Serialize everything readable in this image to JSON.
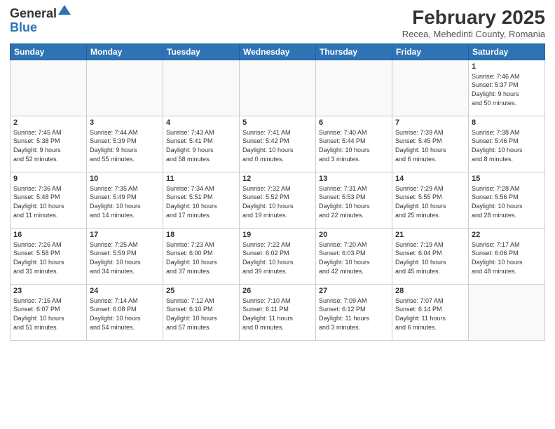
{
  "header": {
    "logo_general": "General",
    "logo_blue": "Blue",
    "month_title": "February 2025",
    "location": "Recea, Mehedinti County, Romania"
  },
  "weekdays": [
    "Sunday",
    "Monday",
    "Tuesday",
    "Wednesday",
    "Thursday",
    "Friday",
    "Saturday"
  ],
  "weeks": [
    [
      {
        "day": "",
        "info": ""
      },
      {
        "day": "",
        "info": ""
      },
      {
        "day": "",
        "info": ""
      },
      {
        "day": "",
        "info": ""
      },
      {
        "day": "",
        "info": ""
      },
      {
        "day": "",
        "info": ""
      },
      {
        "day": "1",
        "info": "Sunrise: 7:46 AM\nSunset: 5:37 PM\nDaylight: 9 hours\nand 50 minutes."
      }
    ],
    [
      {
        "day": "2",
        "info": "Sunrise: 7:45 AM\nSunset: 5:38 PM\nDaylight: 9 hours\nand 52 minutes."
      },
      {
        "day": "3",
        "info": "Sunrise: 7:44 AM\nSunset: 5:39 PM\nDaylight: 9 hours\nand 55 minutes."
      },
      {
        "day": "4",
        "info": "Sunrise: 7:43 AM\nSunset: 5:41 PM\nDaylight: 9 hours\nand 58 minutes."
      },
      {
        "day": "5",
        "info": "Sunrise: 7:41 AM\nSunset: 5:42 PM\nDaylight: 10 hours\nand 0 minutes."
      },
      {
        "day": "6",
        "info": "Sunrise: 7:40 AM\nSunset: 5:44 PM\nDaylight: 10 hours\nand 3 minutes."
      },
      {
        "day": "7",
        "info": "Sunrise: 7:39 AM\nSunset: 5:45 PM\nDaylight: 10 hours\nand 6 minutes."
      },
      {
        "day": "8",
        "info": "Sunrise: 7:38 AM\nSunset: 5:46 PM\nDaylight: 10 hours\nand 8 minutes."
      }
    ],
    [
      {
        "day": "9",
        "info": "Sunrise: 7:36 AM\nSunset: 5:48 PM\nDaylight: 10 hours\nand 11 minutes."
      },
      {
        "day": "10",
        "info": "Sunrise: 7:35 AM\nSunset: 5:49 PM\nDaylight: 10 hours\nand 14 minutes."
      },
      {
        "day": "11",
        "info": "Sunrise: 7:34 AM\nSunset: 5:51 PM\nDaylight: 10 hours\nand 17 minutes."
      },
      {
        "day": "12",
        "info": "Sunrise: 7:32 AM\nSunset: 5:52 PM\nDaylight: 10 hours\nand 19 minutes."
      },
      {
        "day": "13",
        "info": "Sunrise: 7:31 AM\nSunset: 5:53 PM\nDaylight: 10 hours\nand 22 minutes."
      },
      {
        "day": "14",
        "info": "Sunrise: 7:29 AM\nSunset: 5:55 PM\nDaylight: 10 hours\nand 25 minutes."
      },
      {
        "day": "15",
        "info": "Sunrise: 7:28 AM\nSunset: 5:56 PM\nDaylight: 10 hours\nand 28 minutes."
      }
    ],
    [
      {
        "day": "16",
        "info": "Sunrise: 7:26 AM\nSunset: 5:58 PM\nDaylight: 10 hours\nand 31 minutes."
      },
      {
        "day": "17",
        "info": "Sunrise: 7:25 AM\nSunset: 5:59 PM\nDaylight: 10 hours\nand 34 minutes."
      },
      {
        "day": "18",
        "info": "Sunrise: 7:23 AM\nSunset: 6:00 PM\nDaylight: 10 hours\nand 37 minutes."
      },
      {
        "day": "19",
        "info": "Sunrise: 7:22 AM\nSunset: 6:02 PM\nDaylight: 10 hours\nand 39 minutes."
      },
      {
        "day": "20",
        "info": "Sunrise: 7:20 AM\nSunset: 6:03 PM\nDaylight: 10 hours\nand 42 minutes."
      },
      {
        "day": "21",
        "info": "Sunrise: 7:19 AM\nSunset: 6:04 PM\nDaylight: 10 hours\nand 45 minutes."
      },
      {
        "day": "22",
        "info": "Sunrise: 7:17 AM\nSunset: 6:06 PM\nDaylight: 10 hours\nand 48 minutes."
      }
    ],
    [
      {
        "day": "23",
        "info": "Sunrise: 7:15 AM\nSunset: 6:07 PM\nDaylight: 10 hours\nand 51 minutes."
      },
      {
        "day": "24",
        "info": "Sunrise: 7:14 AM\nSunset: 6:08 PM\nDaylight: 10 hours\nand 54 minutes."
      },
      {
        "day": "25",
        "info": "Sunrise: 7:12 AM\nSunset: 6:10 PM\nDaylight: 10 hours\nand 57 minutes."
      },
      {
        "day": "26",
        "info": "Sunrise: 7:10 AM\nSunset: 6:11 PM\nDaylight: 11 hours\nand 0 minutes."
      },
      {
        "day": "27",
        "info": "Sunrise: 7:09 AM\nSunset: 6:12 PM\nDaylight: 11 hours\nand 3 minutes."
      },
      {
        "day": "28",
        "info": "Sunrise: 7:07 AM\nSunset: 6:14 PM\nDaylight: 11 hours\nand 6 minutes."
      },
      {
        "day": "",
        "info": ""
      }
    ]
  ]
}
